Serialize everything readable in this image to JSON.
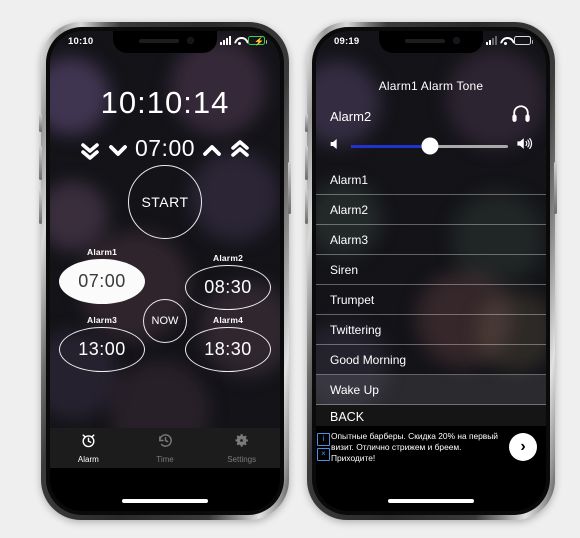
{
  "background_color": "#efefef",
  "left_phone": {
    "status_bar": {
      "time": "10:10",
      "signal_icon": "cellular-bars-icon",
      "wifi_icon": "wifi-icon",
      "battery_icon": "battery-charging-icon",
      "battery_state": "charging"
    },
    "clock": {
      "current_time": "10:10:14",
      "preset_time": "07:00",
      "decrease_fast_icon": "double-chevron-down-icon",
      "decrease_icon": "chevron-down-icon",
      "increase_icon": "chevron-up-icon",
      "increase_fast_icon": "double-chevron-up-icon"
    },
    "start_button_label": "START",
    "now_button_label": "NOW",
    "alarms": [
      {
        "label": "Alarm1",
        "time": "07:00",
        "active": true
      },
      {
        "label": "Alarm2",
        "time": "08:30",
        "active": false
      },
      {
        "label": "Alarm3",
        "time": "13:00",
        "active": false
      },
      {
        "label": "Alarm4",
        "time": "18:30",
        "active": false
      }
    ],
    "tabs": [
      {
        "label": "Alarm",
        "icon": "alarm-clock-icon",
        "active": true
      },
      {
        "label": "Time",
        "icon": "clock-history-icon",
        "active": false
      },
      {
        "label": "Settings",
        "icon": "gear-icon",
        "active": false
      }
    ]
  },
  "right_phone": {
    "status_bar": {
      "time": "09:19",
      "signal_icon": "cellular-bars-icon",
      "wifi_icon": "wifi-icon",
      "battery_icon": "battery-icon",
      "battery_state": "normal"
    },
    "title": "Alarm1 Alarm Tone",
    "selected_tone": "Alarm2",
    "headphones_icon": "headphones-icon",
    "volume": {
      "min_icon": "volume-mute-icon",
      "max_icon": "volume-high-icon",
      "level_percent": 50,
      "fill_color": "#2233cc",
      "track_color": "#a9a9a9"
    },
    "tone_list": [
      {
        "label": "Alarm1",
        "highlight": false
      },
      {
        "label": "Alarm2",
        "highlight": false
      },
      {
        "label": "Alarm3",
        "highlight": false
      },
      {
        "label": "Siren",
        "highlight": false
      },
      {
        "label": "Trumpet",
        "highlight": false
      },
      {
        "label": "Twittering",
        "highlight": false
      },
      {
        "label": "Good Morning",
        "highlight": false
      },
      {
        "label": "Wake Up",
        "highlight": true
      }
    ],
    "back_label": "BACK",
    "ad": {
      "text": "Опытные барберы. Скидка 20% на первый визит. Отлично стрижем и бреем. Приходите!",
      "info_icon": "adchoices-info-icon",
      "info_glyph": "i",
      "close_icon": "ad-close-icon",
      "close_glyph": "×",
      "cta_icon": "chevron-right-icon",
      "cta_glyph": "›"
    }
  }
}
